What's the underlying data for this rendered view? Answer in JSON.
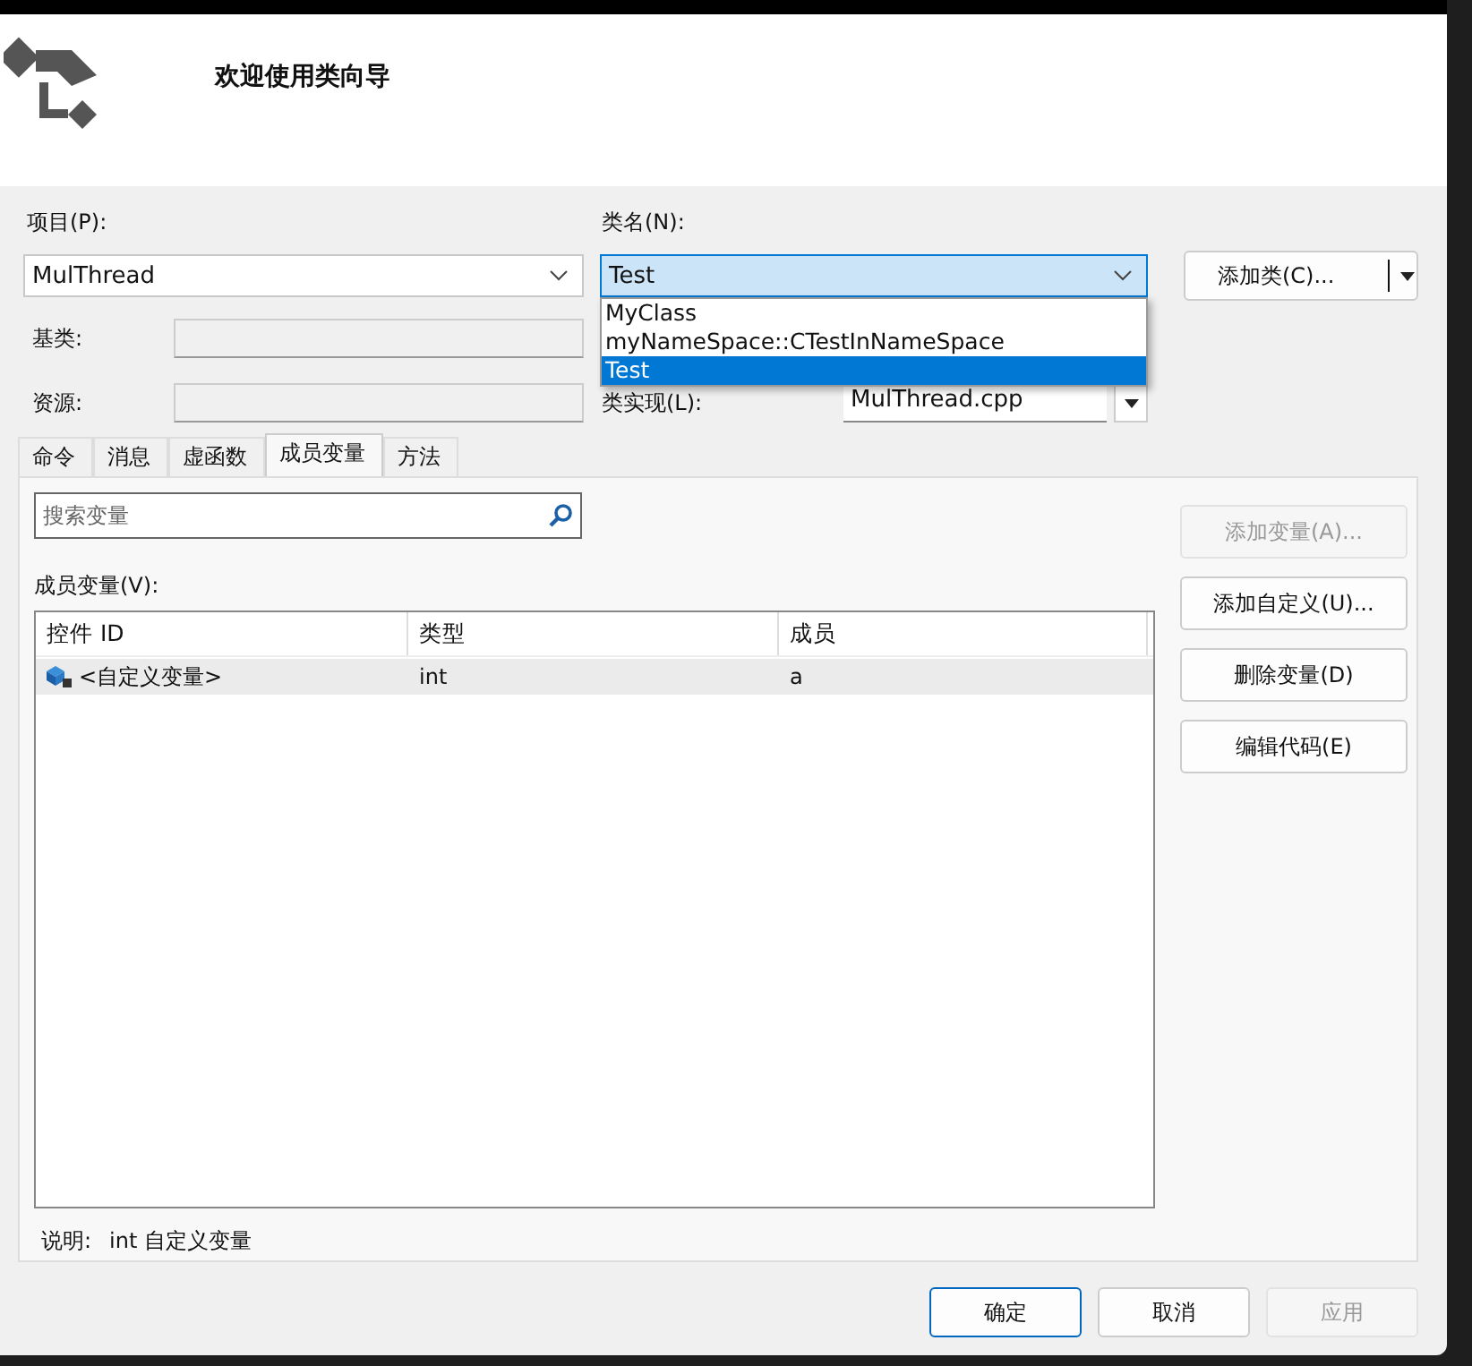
{
  "header": {
    "title": "欢迎使用类向导"
  },
  "project": {
    "label": "项目(P):",
    "value": "MulThread"
  },
  "class_name": {
    "label": "类名(N):",
    "value": "Test",
    "expanded": true,
    "options": [
      {
        "label": "MyClass",
        "selected": false
      },
      {
        "label": "myNameSpace::CTestInNameSpace",
        "selected": false
      },
      {
        "label": "Test",
        "selected": true
      }
    ]
  },
  "add_class_button": {
    "label": "添加类(C)..."
  },
  "base_class": {
    "label": "基类:",
    "disabled": true
  },
  "resource": {
    "label": "资源:",
    "disabled": true
  },
  "class_impl": {
    "label": "类实现(L):",
    "value": "MulThread.cpp"
  },
  "tabs": [
    {
      "label": "命令",
      "selected": false
    },
    {
      "label": "消息",
      "selected": false
    },
    {
      "label": "虚函数",
      "selected": false
    },
    {
      "label": "成员变量",
      "selected": true
    },
    {
      "label": "方法",
      "selected": false
    }
  ],
  "search": {
    "placeholder": "搜索变量"
  },
  "members": {
    "label": "成员变量(V):",
    "columns": [
      "控件 ID",
      "类型",
      "成员"
    ],
    "rows": [
      {
        "cells": [
          "<自定义变量>",
          "int",
          "a"
        ],
        "selected": true
      }
    ]
  },
  "side_buttons": [
    {
      "label": "添加变量(A)...",
      "disabled": true
    },
    {
      "label": "添加自定义(U)...",
      "disabled": false
    },
    {
      "label": "删除变量(D)",
      "disabled": false
    },
    {
      "label": "编辑代码(E)",
      "disabled": false
    }
  ],
  "description": {
    "label": "说明:",
    "value": "int 自定义变量"
  },
  "buttons": [
    {
      "label": "确定",
      "default": true,
      "disabled": false
    },
    {
      "label": "取消",
      "default": false,
      "disabled": false
    },
    {
      "label": "应用",
      "default": false,
      "disabled": true
    }
  ]
}
